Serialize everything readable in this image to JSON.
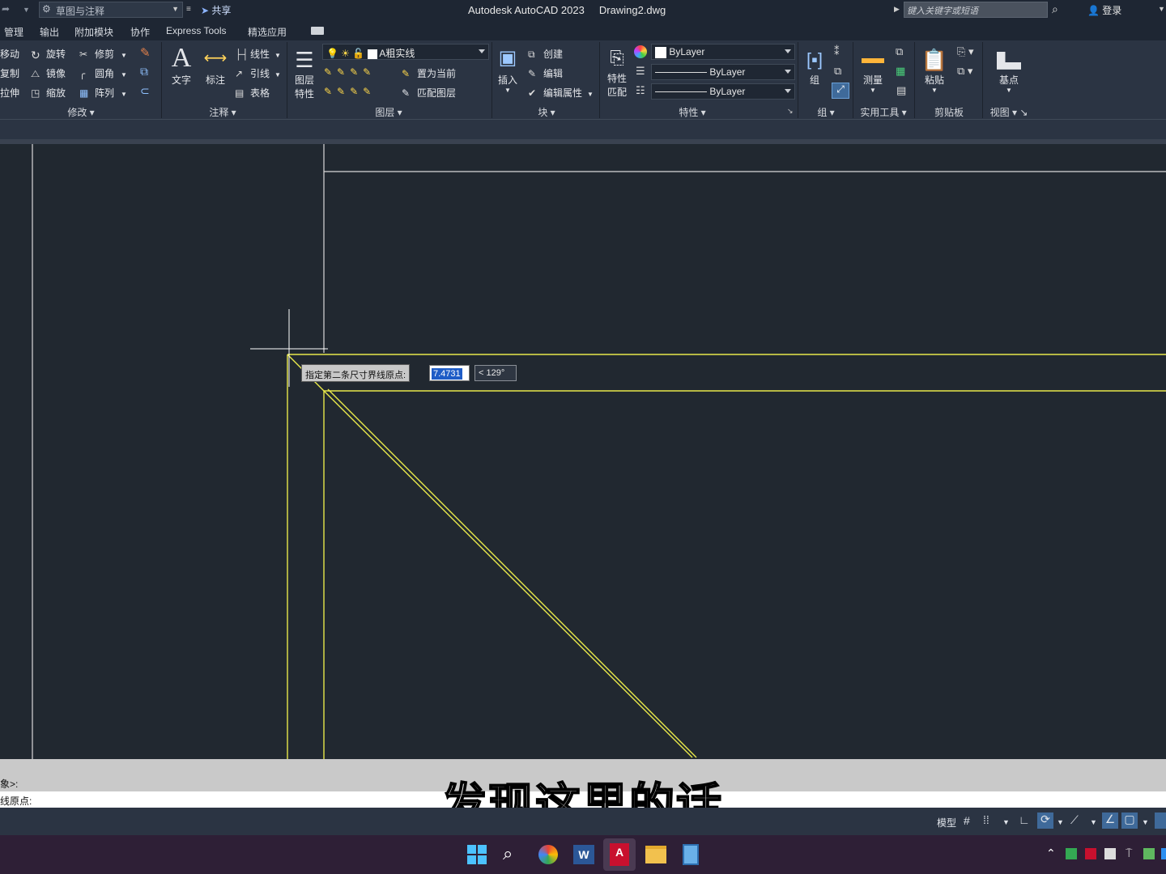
{
  "titlebar": {
    "workspace": "草图与注释",
    "share": "共享",
    "app_title": "Autodesk AutoCAD 2023",
    "file_name": "Drawing2.dwg",
    "search_placeholder": "键入关键字或短语",
    "login": "登录"
  },
  "tabs": [
    "管理",
    "输出",
    "附加模块",
    "协作",
    "Express Tools",
    "精选应用"
  ],
  "ribbon": {
    "modify": {
      "move": "移动",
      "rotate": "旋转",
      "trim": "修剪",
      "copy": "复制",
      "mirror": "镜像",
      "fillet": "圆角",
      "stretch": "拉伸",
      "scale": "缩放",
      "array": "阵列",
      "footer": "修改"
    },
    "annotation": {
      "text": "文字",
      "dimension": "标注",
      "linear": "线性",
      "leader": "引线",
      "table": "表格",
      "footer": "注释"
    },
    "layers": {
      "layer_props_1": "图层",
      "layer_props_2": "特性",
      "current_layer": "A粗实线",
      "set_current": "置为当前",
      "match_layer": "匹配图层",
      "footer": "图层"
    },
    "block": {
      "insert": "插入",
      "create": "创建",
      "edit": "编辑",
      "edit_attrs": "编辑属性",
      "footer": "块"
    },
    "properties": {
      "match_1": "特性",
      "match_2": "匹配",
      "color": "ByLayer",
      "linetype": "ByLayer",
      "lineweight": "ByLayer",
      "footer": "特性"
    },
    "groups": {
      "group": "组",
      "footer": "组"
    },
    "utilities": {
      "measure": "测量",
      "footer": "实用工具"
    },
    "clipboard": {
      "paste": "粘贴",
      "footer": "剪贴板"
    },
    "view": {
      "base": "基点",
      "footer": "视图"
    }
  },
  "drawing": {
    "prompt": "指定第二条尺寸界线原点:",
    "distance_value": "7.4731",
    "angle_value": "< 129°"
  },
  "command": {
    "history_line": "象>:",
    "current_line": "线原点:"
  },
  "subtitle": "发现这里的话",
  "status": {
    "model": "模型"
  },
  "colors": {
    "drawing_bg": "#212830",
    "yellow_line": "#e8e84a",
    "white_line": "#d9d9d9",
    "ribbon_bg": "#2b3443",
    "taskbar_bg": "#2e1f36"
  }
}
